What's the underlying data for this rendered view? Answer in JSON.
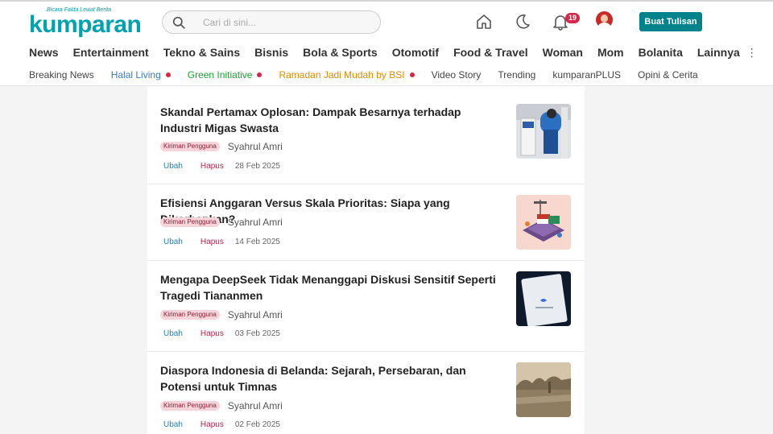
{
  "logo": {
    "tagline": "Bicara Fakta Lewat Berita",
    "wordmark": "kumparan"
  },
  "search": {
    "placeholder": "Cari di sini..."
  },
  "notifications": {
    "count": "19"
  },
  "header": {
    "write_label": "Buat Tulisan"
  },
  "nav_main": [
    "News",
    "Entertainment",
    "Tekno & Sains",
    "Bisnis",
    "Bola & Sports",
    "Otomotif",
    "Food & Travel",
    "Woman",
    "Mom",
    "Bolanita",
    "Lainnya"
  ],
  "nav_sub": [
    {
      "label": "Breaking News",
      "color": "#444444",
      "dot": false
    },
    {
      "label": "Halal Living",
      "color": "#3a7bc8",
      "dot": true
    },
    {
      "label": "Green Initiative",
      "color": "#1aa32f",
      "dot": true
    },
    {
      "label": "Ramadan Jadi Mudah by BSI",
      "color": "#e08a00",
      "dot": true
    },
    {
      "label": "Video Story",
      "color": "#444444",
      "dot": false
    },
    {
      "label": "Trending",
      "color": "#444444",
      "dot": false
    },
    {
      "label": "kumparanPLUS",
      "color": "#444444",
      "dot": false
    },
    {
      "label": "Opini & Cerita",
      "color": "#444444",
      "dot": false
    }
  ],
  "articles": [
    {
      "title": "Skandal Pertamax Oplosan: Dampak Besarnya terhadap Industri Migas Swasta",
      "badge": "Kiriman Pengguna",
      "author": "Syahrul Amri",
      "edit": "Ubah",
      "delete": "Hapus",
      "date": "28 Feb 2025"
    },
    {
      "title": "Efisiensi Anggaran Versus Skala Prioritas: Siapa yang Dikorbankan?",
      "badge": "Kiriman Pengguna",
      "author": "Syahrul Amri",
      "edit": "Ubah",
      "delete": "Hapus",
      "date": "14 Feb 2025"
    },
    {
      "title": "Mengapa DeepSeek Tidak Menanggapi Diskusi Sensitif Seperti Tragedi Tiananmen",
      "badge": "Kiriman Pengguna",
      "author": "Syahrul Amri",
      "edit": "Ubah",
      "delete": "Hapus",
      "date": "03 Feb 2025"
    },
    {
      "title": "Diaspora Indonesia di Belanda: Sejarah, Persebaran, dan Potensi untuk Timnas",
      "badge": "Kiriman Pengguna",
      "author": "Syahrul Amri",
      "edit": "Ubah",
      "delete": "Hapus",
      "date": "02 Feb 2025"
    }
  ],
  "icons": {
    "search": "search-icon",
    "home": "home-icon",
    "theme": "moon-icon",
    "notifications": "bell-icon",
    "more": "more-vertical-icon"
  },
  "colors": {
    "brand": "#00a3ad",
    "button": "#00838a",
    "badge_bg": "#f7d3da",
    "edit": "#2a7fb8",
    "delete": "#b8264a"
  }
}
